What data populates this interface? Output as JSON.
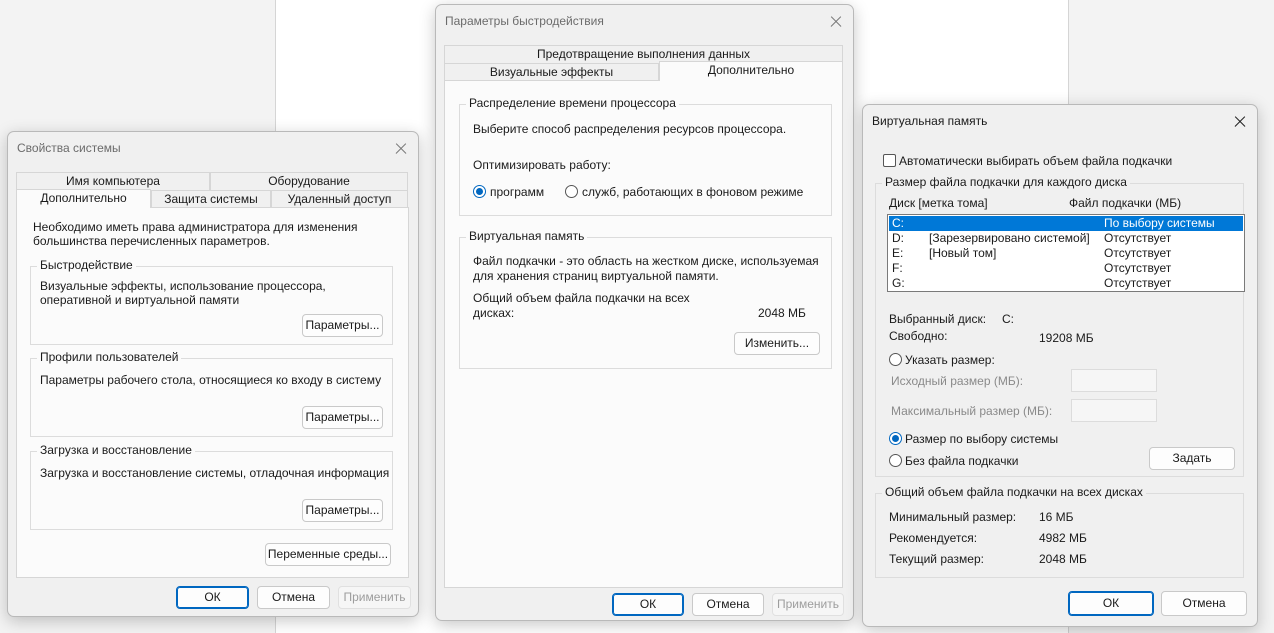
{
  "sys": {
    "title": "Свойства системы",
    "tabs_top": [
      "Имя компьютера",
      "Оборудование"
    ],
    "tabs_bottom": [
      "Дополнительно",
      "Защита системы",
      "Удаленный доступ"
    ],
    "admin_note": "Необходимо иметь права администратора для изменения большинства перечисленных параметров.",
    "perf": {
      "title": "Быстродействие",
      "desc": "Визуальные эффекты, использование процессора, оперативной и виртуальной памяти",
      "button": "Параметры..."
    },
    "profiles": {
      "title": "Профили пользователей",
      "desc": "Параметры рабочего стола, относящиеся ко входу в систему",
      "button": "Параметры..."
    },
    "startup": {
      "title": "Загрузка и восстановление",
      "desc": "Загрузка и восстановление системы, отладочная информация",
      "button": "Параметры..."
    },
    "env_button": "Переменные среды...",
    "ok": "ОК",
    "cancel": "Отмена",
    "apply": "Применить"
  },
  "perf": {
    "title": "Параметры быстродействия",
    "tab_top": "Предотвращение выполнения данных",
    "tabs": [
      "Визуальные эффекты",
      "Дополнительно"
    ],
    "cpu": {
      "title": "Распределение времени процессора",
      "desc": "Выберите способ распределения ресурсов процессора.",
      "optimize_label": "Оптимизировать работу:",
      "opt_programs": "программ",
      "opt_services": "служб, работающих в фоновом режиме"
    },
    "vm": {
      "title": "Виртуальная память",
      "desc": "Файл подкачки - это область на жестком диске, используемая для хранения страниц виртуальной памяти.",
      "total_label": "Общий объем файла подкачки на всех дисках:",
      "total_value": "2048 МБ",
      "change_button": "Изменить..."
    },
    "ok": "ОК",
    "cancel": "Отмена",
    "apply": "Применить"
  },
  "vm": {
    "title": "Виртуальная память",
    "auto_label": "Автоматически выбирать объем файла подкачки",
    "group_title": "Размер файла подкачки для каждого диска",
    "col_drive": "Диск [метка тома]",
    "col_size": "Файл подкачки (МБ)",
    "drives": [
      {
        "letter": "C:",
        "label": "",
        "status": "По выбору системы",
        "selected": true
      },
      {
        "letter": "D:",
        "label": "[Зарезервировано системой]",
        "status": "Отсутствует",
        "selected": false
      },
      {
        "letter": "E:",
        "label": "[Новый том]",
        "status": "Отсутствует",
        "selected": false
      },
      {
        "letter": "F:",
        "label": "",
        "status": "Отсутствует",
        "selected": false
      },
      {
        "letter": "G:",
        "label": "",
        "status": "Отсутствует",
        "selected": false
      }
    ],
    "selected_label": "Выбранный диск:",
    "selected_value": "C:",
    "free_label": "Свободно:",
    "free_value": "19208 МБ",
    "custom_label": "Указать размер:",
    "initial_label": "Исходный размер (МБ):",
    "max_label": "Максимальный размер (МБ):",
    "system_label": "Размер по выбору системы",
    "nofile_label": "Без файла подкачки",
    "set_button": "Задать",
    "totals_title": "Общий объем файла подкачки на всех дисках",
    "min_label": "Минимальный размер:",
    "min_value": "16 МБ",
    "rec_label": "Рекомендуется:",
    "rec_value": "4982 МБ",
    "cur_label": "Текущий размер:",
    "cur_value": "2048 МБ",
    "ok": "ОК",
    "cancel": "Отмена"
  }
}
